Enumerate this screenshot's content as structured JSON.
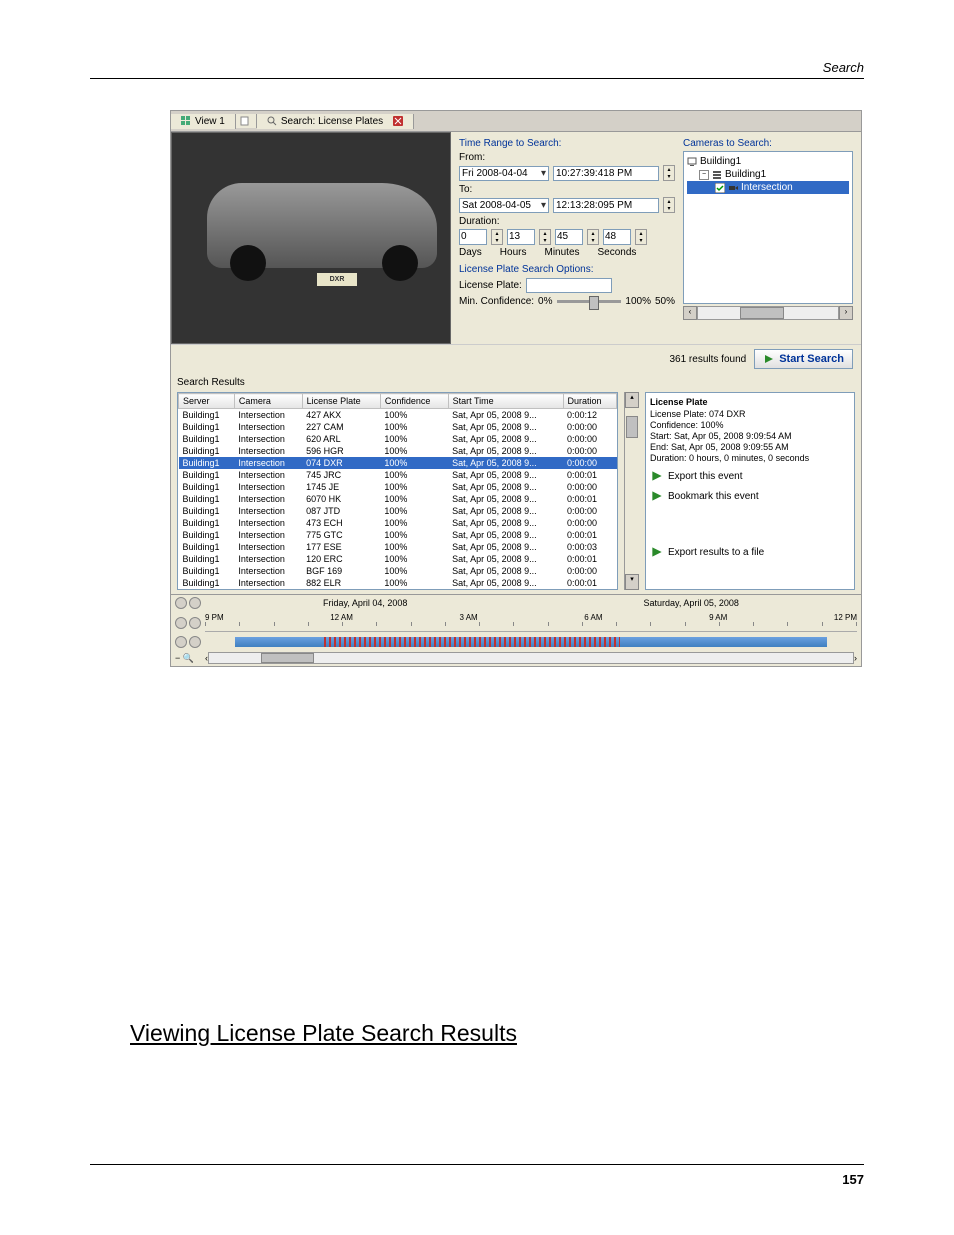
{
  "header": {
    "section_title": "Search"
  },
  "tabs": {
    "view": "View 1",
    "search": "Search: License Plates"
  },
  "time_range": {
    "label": "Time Range to Search:",
    "from_label": "From:",
    "from_date": "Fri   2008-04-04",
    "from_time": "10:27:39:418  PM",
    "to_label": "To:",
    "to_date": "Sat   2008-04-05",
    "to_time": "12:13:28:095  PM",
    "duration_label": "Duration:",
    "days": "0",
    "hours": "13",
    "minutes": "45",
    "seconds": "48",
    "days_l": "Days",
    "hours_l": "Hours",
    "minutes_l": "Minutes",
    "seconds_l": "Seconds"
  },
  "lp_options": {
    "label": "License Plate Search Options:",
    "plate_label": "License Plate:",
    "plate_value": "",
    "conf_label": "Min. Confidence:",
    "conf_min": "0%",
    "conf_max": "100%",
    "conf_val": "50%"
  },
  "cameras": {
    "label": "Cameras to Search:",
    "root": "Building1",
    "site": "Building1",
    "cam": "Intersection"
  },
  "action": {
    "count": "361 results found",
    "start": "Start Search"
  },
  "results": {
    "title": "Search Results",
    "columns": [
      "Server",
      "Camera",
      "License Plate",
      "Confidence",
      "Start Time",
      "Duration"
    ],
    "rows": [
      {
        "server": "Building1",
        "camera": "Intersection",
        "plate": "427 AKX",
        "conf": "100%",
        "start": "Sat, Apr 05, 2008 9...",
        "dur": "0:00:12"
      },
      {
        "server": "Building1",
        "camera": "Intersection",
        "plate": "227 CAM",
        "conf": "100%",
        "start": "Sat, Apr 05, 2008 9...",
        "dur": "0:00:00"
      },
      {
        "server": "Building1",
        "camera": "Intersection",
        "plate": "620 ARL",
        "conf": "100%",
        "start": "Sat, Apr 05, 2008 9...",
        "dur": "0:00:00"
      },
      {
        "server": "Building1",
        "camera": "Intersection",
        "plate": "596 HGR",
        "conf": "100%",
        "start": "Sat, Apr 05, 2008 9...",
        "dur": "0:00:00"
      },
      {
        "server": "Building1",
        "camera": "Intersection",
        "plate": "074 DXR",
        "conf": "100%",
        "start": "Sat, Apr 05, 2008 9...",
        "dur": "0:00:00",
        "selected": true
      },
      {
        "server": "Building1",
        "camera": "Intersection",
        "plate": "745 JRC",
        "conf": "100%",
        "start": "Sat, Apr 05, 2008 9...",
        "dur": "0:00:01"
      },
      {
        "server": "Building1",
        "camera": "Intersection",
        "plate": "1745 JE",
        "conf": "100%",
        "start": "Sat, Apr 05, 2008 9...",
        "dur": "0:00:00"
      },
      {
        "server": "Building1",
        "camera": "Intersection",
        "plate": "6070 HK",
        "conf": "100%",
        "start": "Sat, Apr 05, 2008 9...",
        "dur": "0:00:01"
      },
      {
        "server": "Building1",
        "camera": "Intersection",
        "plate": "087 JTD",
        "conf": "100%",
        "start": "Sat, Apr 05, 2008 9...",
        "dur": "0:00:00"
      },
      {
        "server": "Building1",
        "camera": "Intersection",
        "plate": "473 ECH",
        "conf": "100%",
        "start": "Sat, Apr 05, 2008 9...",
        "dur": "0:00:00"
      },
      {
        "server": "Building1",
        "camera": "Intersection",
        "plate": "775 GTC",
        "conf": "100%",
        "start": "Sat, Apr 05, 2008 9...",
        "dur": "0:00:01"
      },
      {
        "server": "Building1",
        "camera": "Intersection",
        "plate": "177 ESE",
        "conf": "100%",
        "start": "Sat, Apr 05, 2008 9...",
        "dur": "0:00:03"
      },
      {
        "server": "Building1",
        "camera": "Intersection",
        "plate": "120 ERC",
        "conf": "100%",
        "start": "Sat, Apr 05, 2008 9...",
        "dur": "0:00:01"
      },
      {
        "server": "Building1",
        "camera": "Intersection",
        "plate": "BGF 169",
        "conf": "100%",
        "start": "Sat, Apr 05, 2008 9...",
        "dur": "0:00:00"
      },
      {
        "server": "Building1",
        "camera": "Intersection",
        "plate": "882 ELR",
        "conf": "100%",
        "start": "Sat, Apr 05, 2008 9...",
        "dur": "0:00:01"
      }
    ]
  },
  "detail": {
    "header": "License Plate",
    "plate": "License Plate: 074 DXR",
    "conf": "Confidence: 100%",
    "start": "Start: Sat, Apr 05, 2008 9:09:54 AM",
    "end": "End: Sat, Apr 05, 2008 9:09:55 AM",
    "duration": "Duration: 0 hours, 0 minutes, 0 seconds",
    "export_event": "Export this event",
    "bookmark": "Bookmark this event",
    "export_file": "Export results to a file"
  },
  "timeline": {
    "date1": "Friday, April 04, 2008",
    "date2": "Saturday, April 05, 2008",
    "hours": [
      "9 PM",
      "12 AM",
      "3 AM",
      "6 AM",
      "9 AM",
      "12 PM"
    ]
  },
  "heading": "Viewing License Plate Search Results",
  "page_number": "157",
  "plate_image": "DXR"
}
